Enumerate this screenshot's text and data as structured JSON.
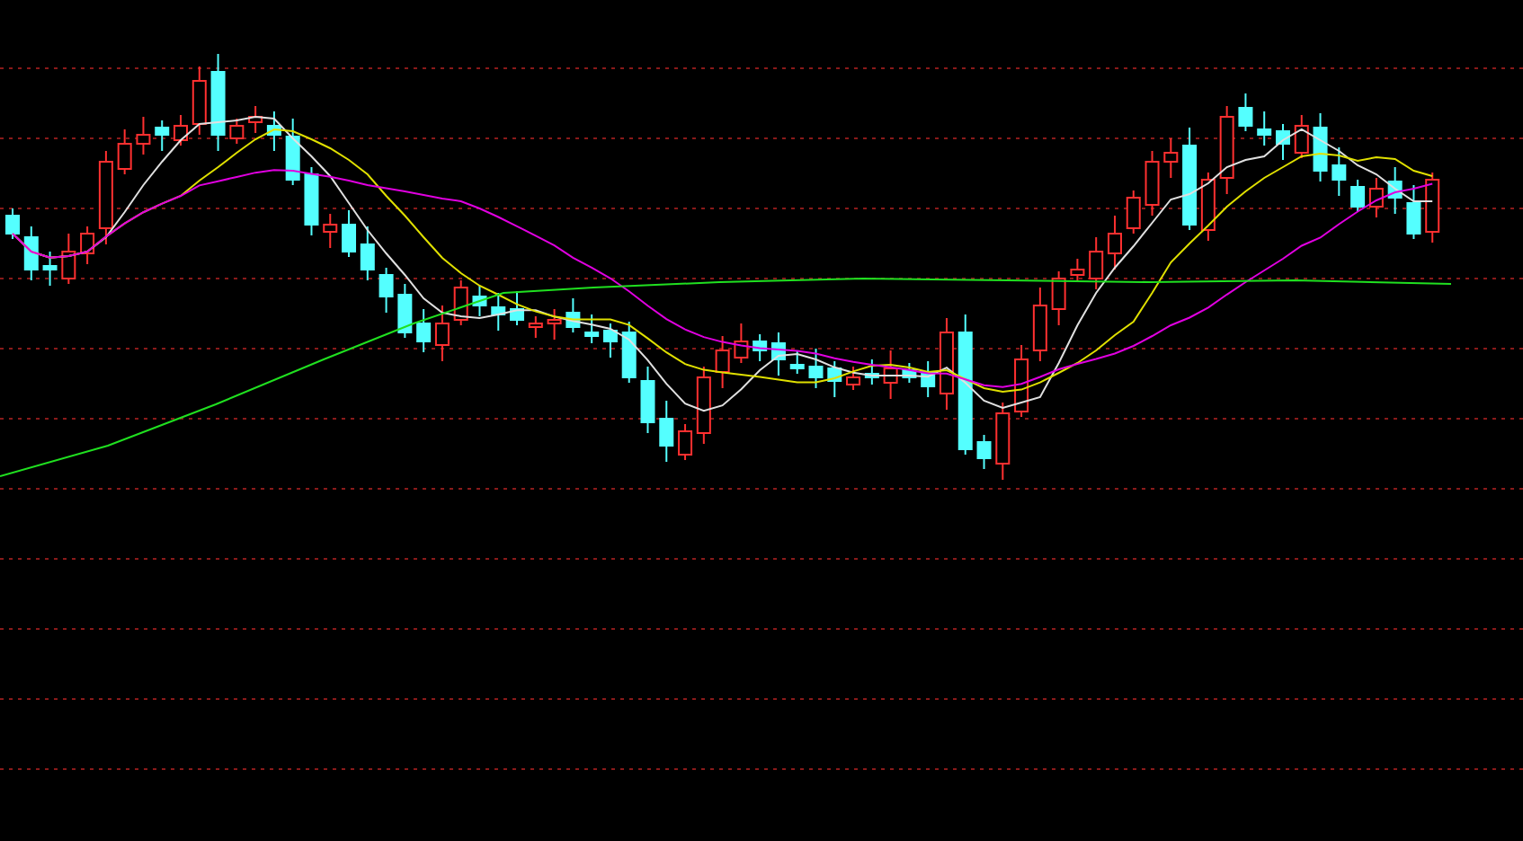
{
  "panel": {
    "kind": "candlestick"
  }
}
